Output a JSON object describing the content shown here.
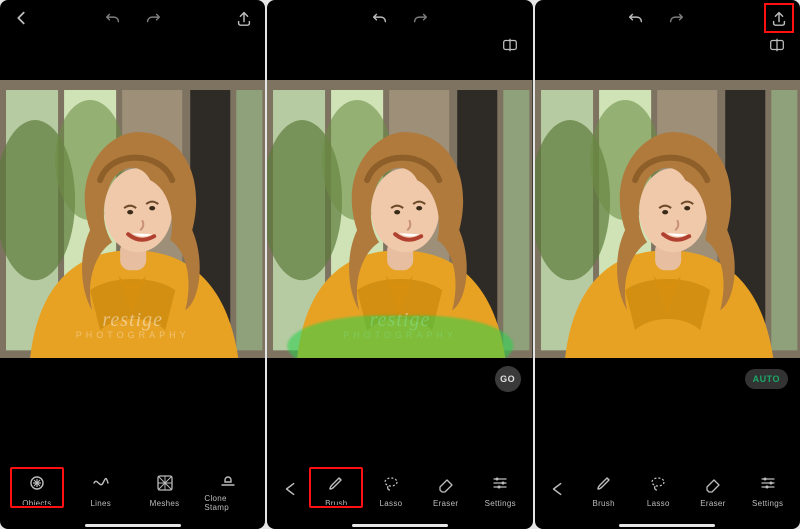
{
  "watermark": {
    "brand": "restige",
    "sub": "PHOTOGRAPHY"
  },
  "icons": {
    "back": "chevron-left",
    "undo": "undo",
    "redo": "redo",
    "upload": "upload",
    "compare": "compare",
    "go": "GO",
    "auto": "AUTO"
  },
  "panels": [
    {
      "id": "step1",
      "top": {
        "back": true,
        "undo": true,
        "redo": true,
        "upload": true,
        "compare": false,
        "undo_dim": true,
        "redo_dim": true,
        "highlight_upload": false
      },
      "action": null,
      "has_brush_mask": false,
      "has_watermark": true,
      "toolbar": {
        "back": false,
        "tools": [
          {
            "key": "objects",
            "label": "Objects",
            "icon": "sparkle",
            "highlight": true
          },
          {
            "key": "lines",
            "label": "Lines",
            "icon": "lines",
            "highlight": false
          },
          {
            "key": "meshes",
            "label": "Meshes",
            "icon": "meshes",
            "highlight": false
          },
          {
            "key": "clonestamp",
            "label": "Clone Stamp",
            "icon": "stamp",
            "highlight": false
          }
        ]
      }
    },
    {
      "id": "step2",
      "top": {
        "back": false,
        "undo": true,
        "redo": true,
        "upload": false,
        "compare": true,
        "undo_dim": false,
        "redo_dim": true,
        "highlight_upload": false
      },
      "action": "go",
      "has_brush_mask": true,
      "has_watermark": true,
      "toolbar": {
        "back": true,
        "tools": [
          {
            "key": "brush",
            "label": "Brush",
            "icon": "brush",
            "highlight": true
          },
          {
            "key": "lasso",
            "label": "Lasso",
            "icon": "lasso",
            "highlight": false
          },
          {
            "key": "eraser",
            "label": "Eraser",
            "icon": "eraser",
            "highlight": false
          },
          {
            "key": "settings",
            "label": "Settings",
            "icon": "sliders",
            "highlight": false
          }
        ]
      }
    },
    {
      "id": "step3",
      "top": {
        "back": false,
        "undo": true,
        "redo": true,
        "upload": true,
        "compare": true,
        "undo_dim": false,
        "redo_dim": true,
        "highlight_upload": true
      },
      "action": "auto",
      "has_brush_mask": false,
      "has_watermark": false,
      "toolbar": {
        "back": true,
        "tools": [
          {
            "key": "brush",
            "label": "Brush",
            "icon": "brush",
            "highlight": false
          },
          {
            "key": "lasso",
            "label": "Lasso",
            "icon": "lasso",
            "highlight": false
          },
          {
            "key": "eraser",
            "label": "Eraser",
            "icon": "eraser",
            "highlight": false
          },
          {
            "key": "settings",
            "label": "Settings",
            "icon": "sliders",
            "highlight": false
          }
        ]
      }
    }
  ]
}
